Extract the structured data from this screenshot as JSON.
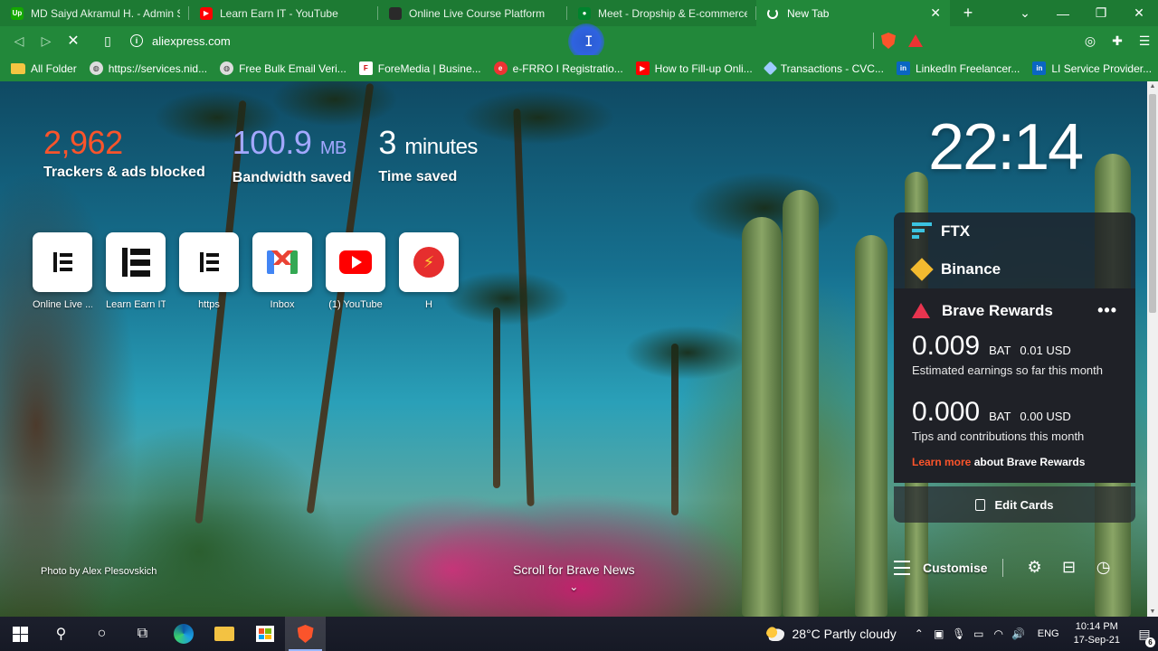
{
  "browser": {
    "tabs": [
      {
        "title": "MD Saiyd Akramul H. - Admin Sup",
        "favicon": "upwork-icon",
        "favicon_text": "Up"
      },
      {
        "title": "Learn Earn IT - YouTube",
        "favicon": "youtube-icon"
      },
      {
        "title": "Online Live Course Platform",
        "favicon": "site-icon"
      },
      {
        "title": "Meet - Dropship & E-commerce",
        "favicon": "meet-icon"
      },
      {
        "title": "New Tab",
        "favicon": "loading-spinner-icon",
        "active": true
      }
    ],
    "new_tab_glyph": "+",
    "window_controls": {
      "menu": "⌄",
      "minimize": "—",
      "maximize": "❐",
      "close": "✕"
    },
    "address": {
      "value": "aliexpress.com",
      "info_glyph": "i"
    },
    "nav": {
      "back": "◁",
      "forward": "▷",
      "stop": "✕",
      "bookmark": "🔖"
    },
    "bookmarks": [
      {
        "label": "All Folder",
        "icon": "folder-icon"
      },
      {
        "label": "https://services.nid...",
        "icon": "globe-icon"
      },
      {
        "label": "Free Bulk Email Veri...",
        "icon": "globe-icon"
      },
      {
        "label": "ForeMedia | Busine...",
        "icon": "foremedia-icon",
        "icon_text": "F"
      },
      {
        "label": "e-FRRO I Registratio...",
        "icon": "efrro-icon",
        "icon_text": "e"
      },
      {
        "label": "How to Fill-up Onli...",
        "icon": "youtube-icon"
      },
      {
        "label": "Transactions - CVC...",
        "icon": "transactions-icon"
      },
      {
        "label": "LinkedIn Freelancer...",
        "icon": "linkedin-icon",
        "icon_text": "in"
      },
      {
        "label": "LI Service Provider...",
        "icon": "linkedin-icon",
        "icon_text": "in"
      }
    ],
    "bookmarks_more": "»"
  },
  "newtab": {
    "stats": [
      {
        "value": "2,962",
        "unit": "",
        "label": "Trackers & ads blocked"
      },
      {
        "value": "100.9",
        "unit": "MB",
        "label": "Bandwidth saved"
      },
      {
        "value": "3",
        "unit": "minutes",
        "label": "Time saved"
      }
    ],
    "clock": "22:14",
    "top_sites": [
      {
        "name": "Online Live ...",
        "logo": "elementor-icon"
      },
      {
        "name": "Learn Earn IT",
        "logo": "elementor-icon"
      },
      {
        "name": "https",
        "logo": "elementor-icon"
      },
      {
        "name": "Inbox",
        "logo": "gmail-icon"
      },
      {
        "name": "(1) YouTube",
        "logo": "youtube-icon"
      },
      {
        "name": "H",
        "logo": "lightning-icon"
      }
    ],
    "widgets": {
      "ftx": "FTX",
      "binance": "Binance",
      "rewards": {
        "title": "Brave Rewards",
        "menu": "•••",
        "earnings": {
          "value": "0.009",
          "bat": "BAT",
          "usd": "0.01 USD",
          "desc": "Estimated earnings so far this month"
        },
        "tips": {
          "value": "0.000",
          "bat": "BAT",
          "usd": "0.00 USD",
          "desc": "Tips and contributions this month"
        },
        "learn_more": "Learn more",
        "learn_more_rest": "about Brave Rewards"
      },
      "edit_cards": "Edit Cards"
    },
    "photo_credit": "Photo by Alex Plesovskich",
    "scroll_news": "Scroll for Brave News",
    "customise": "Customise"
  },
  "taskbar": {
    "weather": {
      "temp": "28°C",
      "condition": "Partly cloudy"
    },
    "language": "ENG",
    "time": "10:14 PM",
    "date": "17-Sep-21",
    "notifications": "6"
  },
  "colors": {
    "chrome_green": "#22883a",
    "tab_green": "#1d7a33",
    "trackers": "#fb542b",
    "bandwidth": "#a3a8ff",
    "brave_orange": "#fb542b"
  }
}
